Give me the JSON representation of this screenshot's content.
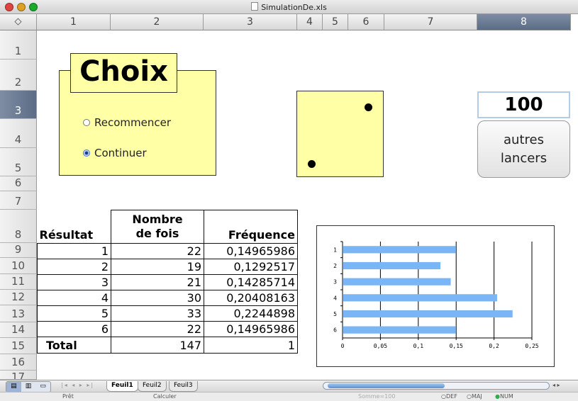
{
  "window": {
    "title": "SimulationDe.xls"
  },
  "columns": [
    "1",
    "2",
    "3",
    "4",
    "5",
    "6",
    "7",
    "8"
  ],
  "rows": [
    "1",
    "2",
    "3",
    "4",
    "5",
    "6",
    "7",
    "8",
    "9",
    "10",
    "11",
    "12",
    "13",
    "14",
    "15",
    "16",
    "17"
  ],
  "corner_symbol": "◇",
  "choice": {
    "title": "Choix",
    "options": [
      {
        "label": "Recommencer",
        "selected": false
      },
      {
        "label": "Continuer",
        "selected": true
      }
    ]
  },
  "die": {
    "face": 2
  },
  "counter": {
    "value": "100"
  },
  "button": {
    "line1": "autres",
    "line2": "lancers"
  },
  "table": {
    "headers": [
      "Résultat",
      "Nombre",
      "de fois",
      "Fréquence"
    ],
    "rows": [
      {
        "resultat": "1",
        "nombre": "22",
        "frequence": "0,14965986"
      },
      {
        "resultat": "2",
        "nombre": "19",
        "frequence": "0,1292517"
      },
      {
        "resultat": "3",
        "nombre": "21",
        "frequence": "0,14285714"
      },
      {
        "resultat": "4",
        "nombre": "30",
        "frequence": "0,20408163"
      },
      {
        "resultat": "5",
        "nombre": "33",
        "frequence": "0,2244898"
      },
      {
        "resultat": "6",
        "nombre": "22",
        "frequence": "0,14965986"
      }
    ],
    "total_label": "Total",
    "total_nombre": "147",
    "total_frequence": "1"
  },
  "chart_data": {
    "type": "bar",
    "orientation": "horizontal",
    "categories": [
      "1",
      "2",
      "3",
      "4",
      "5",
      "6"
    ],
    "values": [
      0.14965986,
      0.1292517,
      0.14285714,
      0.20408163,
      0.2244898,
      0.14965986
    ],
    "xlim": [
      0,
      0.25
    ],
    "xticks": [
      "0",
      "0,05",
      "0,1",
      "0,15",
      "0,2",
      "0,25"
    ],
    "grid": true,
    "bar_color": "#7ab6f5"
  },
  "sheets": [
    "Feuil1",
    "Feuil2",
    "Feuil3"
  ],
  "status": {
    "ready": "Prêt",
    "calc": "Calculer",
    "sum": "Somme=100",
    "def": "DEF",
    "maj": "MAJ",
    "num": "NUM"
  },
  "colors": {
    "note_yellow": "#ffffa6",
    "selected_header": "#5b6c86"
  }
}
